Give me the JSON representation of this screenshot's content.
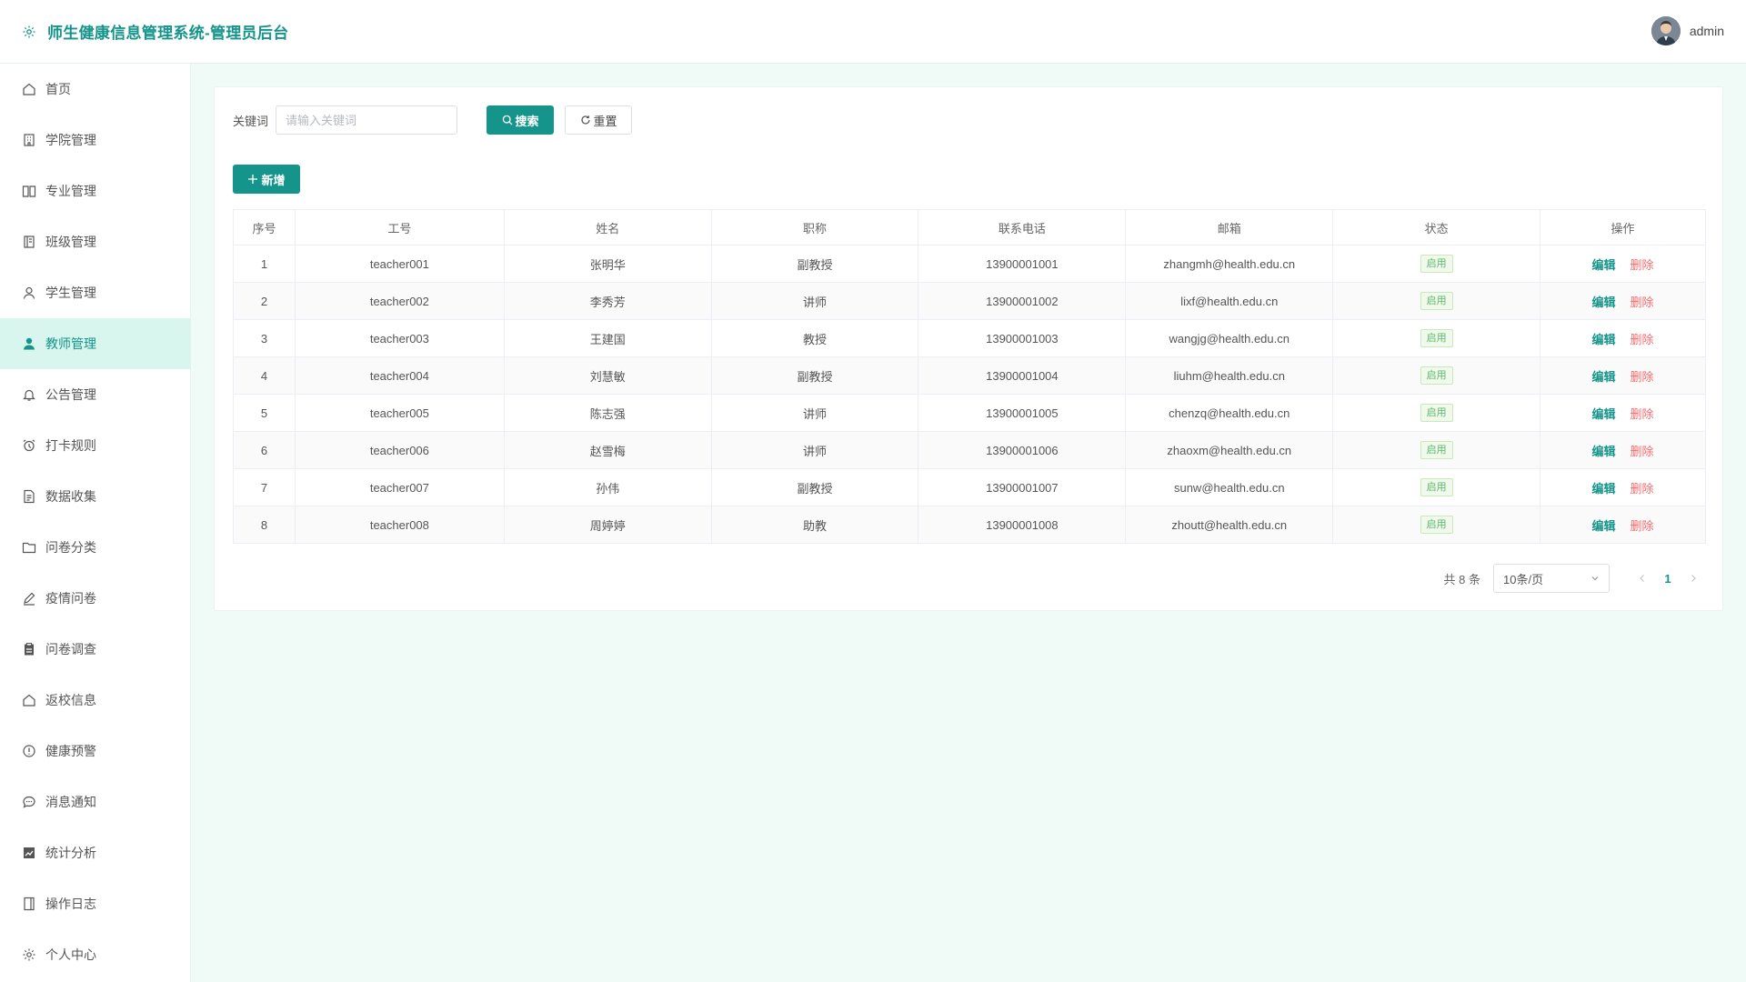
{
  "header": {
    "title": "师生健康信息管理系统-管理员后台",
    "username": "admin"
  },
  "sidebar": {
    "items": [
      {
        "label": "首页",
        "icon": "home-icon"
      },
      {
        "label": "学院管理",
        "icon": "building-icon"
      },
      {
        "label": "专业管理",
        "icon": "book-icon"
      },
      {
        "label": "班级管理",
        "icon": "notebook-icon"
      },
      {
        "label": "学生管理",
        "icon": "user-icon"
      },
      {
        "label": "教师管理",
        "icon": "user-filled-icon",
        "active": true
      },
      {
        "label": "公告管理",
        "icon": "bell-icon"
      },
      {
        "label": "打卡规则",
        "icon": "alarm-clock-icon"
      },
      {
        "label": "数据收集",
        "icon": "document-icon"
      },
      {
        "label": "问卷分类",
        "icon": "folder-icon"
      },
      {
        "label": "疫情问卷",
        "icon": "edit-pen-icon"
      },
      {
        "label": "问卷调查",
        "icon": "clipboard-icon"
      },
      {
        "label": "返校信息",
        "icon": "house-icon"
      },
      {
        "label": "健康预警",
        "icon": "warning-icon"
      },
      {
        "label": "消息通知",
        "icon": "chat-icon"
      },
      {
        "label": "统计分析",
        "icon": "trend-chart-icon"
      },
      {
        "label": "操作日志",
        "icon": "log-book-icon"
      },
      {
        "label": "个人中心",
        "icon": "setting-icon"
      }
    ]
  },
  "search": {
    "label": "关键词",
    "placeholder": "请输入关键词",
    "value": "",
    "search_label": "搜索",
    "reset_label": "重置"
  },
  "toolbar": {
    "add_label": "新增"
  },
  "table": {
    "columns": [
      "序号",
      "工号",
      "姓名",
      "职称",
      "联系电话",
      "邮箱",
      "状态",
      "操作"
    ],
    "edit_label": "编辑",
    "delete_label": "删除",
    "rows": [
      {
        "no": "1",
        "id": "teacher001",
        "name": "张明华",
        "title": "副教授",
        "phone": "13900001001",
        "email": "zhangmh@health.edu.cn",
        "status": "启用"
      },
      {
        "no": "2",
        "id": "teacher002",
        "name": "李秀芳",
        "title": "讲师",
        "phone": "13900001002",
        "email": "lixf@health.edu.cn",
        "status": "启用"
      },
      {
        "no": "3",
        "id": "teacher003",
        "name": "王建国",
        "title": "教授",
        "phone": "13900001003",
        "email": "wangjg@health.edu.cn",
        "status": "启用"
      },
      {
        "no": "4",
        "id": "teacher004",
        "name": "刘慧敏",
        "title": "副教授",
        "phone": "13900001004",
        "email": "liuhm@health.edu.cn",
        "status": "启用"
      },
      {
        "no": "5",
        "id": "teacher005",
        "name": "陈志强",
        "title": "讲师",
        "phone": "13900001005",
        "email": "chenzq@health.edu.cn",
        "status": "启用"
      },
      {
        "no": "6",
        "id": "teacher006",
        "name": "赵雪梅",
        "title": "讲师",
        "phone": "13900001006",
        "email": "zhaoxm@health.edu.cn",
        "status": "启用"
      },
      {
        "no": "7",
        "id": "teacher007",
        "name": "孙伟",
        "title": "副教授",
        "phone": "13900001007",
        "email": "sunw@health.edu.cn",
        "status": "启用"
      },
      {
        "no": "8",
        "id": "teacher008",
        "name": "周婷婷",
        "title": "助教",
        "phone": "13900001008",
        "email": "zhoutt@health.edu.cn",
        "status": "启用"
      }
    ]
  },
  "pagination": {
    "total_text": "共 8 条",
    "page_size": "10条/页",
    "current_page": "1"
  },
  "colors": {
    "primary": "#14948a",
    "active_bg": "#d9f6ee",
    "danger": "#f56c6c",
    "success_tag": "#5ab86b"
  }
}
